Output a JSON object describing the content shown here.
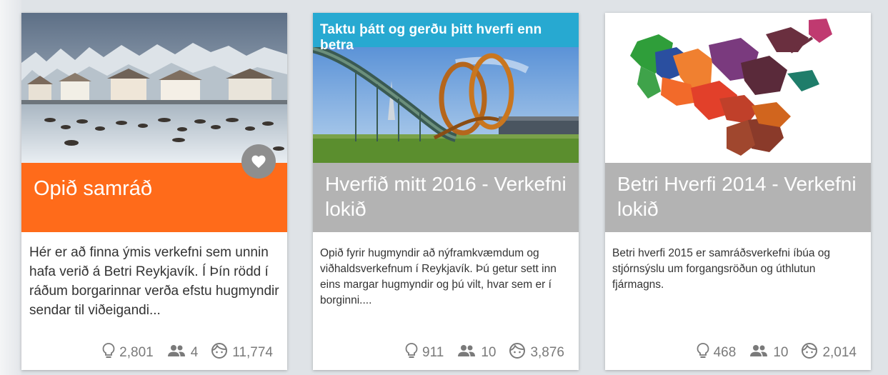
{
  "cards": [
    {
      "title": "Opið samráð",
      "description": "Hér er að finna ýmis verkefni sem un­nin hafa verið á Betri Reykjavík. Í Þín rödd í ráðum borgarinnar verða efstu hugmyndir sendar til viðeigandi...",
      "stats": {
        "ideas": "2,801",
        "users": "4",
        "views": "11,774"
      },
      "title_color": "#ff6b1a"
    },
    {
      "banner": "Taktu þátt og gerðu þitt hverfi enn betra",
      "title": "Hverfið mitt 2016 - Verkefni lokið",
      "description": "Opið fyrir hugmyndir að nýframkvæmdum og viðhaldsverkefnum í Reykjavík. Þú getur sett inn eins margar hugmyndir og þú vilt, hvar sem er í borginni....",
      "stats": {
        "ideas": "911",
        "users": "10",
        "views": "3,876"
      },
      "title_color": "#b3b3b3"
    },
    {
      "title": "Betri Hverfi 2014 - Verkefni lokið",
      "description": "Betri hverfi 2015 er samráðsverkefni íbúa og stjórnsýslu um forgangsröðun og úthlu­tun fjármagns.",
      "stats": {
        "ideas": "468",
        "users": "10",
        "views": "2,014"
      },
      "title_color": "#b3b3b3"
    }
  ],
  "icons": {
    "idea": "lightbulb-icon",
    "users": "people-icon",
    "views": "face-icon",
    "favorite": "heart-icon"
  }
}
